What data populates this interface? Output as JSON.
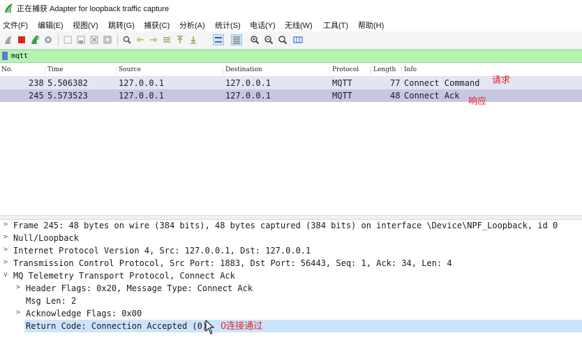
{
  "window": {
    "title": "正在捕获 Adapter for loopback traffic capture"
  },
  "menu": [
    "文件(F)",
    "编辑(E)",
    "视图(V)",
    "跳转(G)",
    "捕获(C)",
    "分析(A)",
    "统计(S)",
    "电话(Y)",
    "无线(W)",
    "工具(T)",
    "帮助(H)"
  ],
  "filter": {
    "value": "mqtt"
  },
  "columns": [
    "No.",
    "Time",
    "Source",
    "Destination",
    "Protocol",
    "Length",
    "Info"
  ],
  "packets": [
    {
      "no": "238",
      "time": "5.506382",
      "source": "127.0.0.1",
      "destination": "127.0.0.1",
      "protocol": "MQTT",
      "length": "77",
      "info": "Connect Command"
    },
    {
      "no": "245",
      "time": "5.573523",
      "source": "127.0.0.1",
      "destination": "127.0.0.1",
      "protocol": "MQTT",
      "length": "48",
      "info": "Connect Ack"
    }
  ],
  "annotations": {
    "request": "请求",
    "response": "响应",
    "accepted": "0连接通过"
  },
  "details": [
    {
      "arrow": ">",
      "text": "Frame 245: 48 bytes on wire (384 bits), 48 bytes captured (384 bits) on interface \\Device\\NPF_Loopback, id 0"
    },
    {
      "arrow": ">",
      "text": "Null/Loopback"
    },
    {
      "arrow": ">",
      "text": "Internet Protocol Version 4, Src: 127.0.0.1, Dst: 127.0.0.1"
    },
    {
      "arrow": ">",
      "text": "Transmission Control Protocol, Src Port: 1883, Dst Port: 56443, Seq: 1, Ack: 34, Len: 4"
    },
    {
      "arrow": "v",
      "text": "MQ Telemetry Transport Protocol, Connect Ack"
    },
    {
      "arrow": ">",
      "text": "Header Flags: 0x20, Message Type: Connect Ack"
    },
    {
      "arrow": "",
      "text": "Msg Len: 2"
    },
    {
      "arrow": ">",
      "text": "Acknowledge Flags: 0x00"
    },
    {
      "arrow": "",
      "text": "Return Code: Connection Accepted (0)"
    }
  ],
  "colors": {
    "filter_bg": "#b3f4b3",
    "row_selected": "#c7c7e0",
    "row_normal": "#e4e4f4",
    "annotation": "#e0232e",
    "tree_selected": "#cce4fa"
  },
  "icons": [
    "shark-fin-start-icon",
    "stop-icon",
    "restart-icon",
    "options-icon",
    "open-icon",
    "save-icon",
    "close-file-icon",
    "reload-icon",
    "find-icon",
    "back-icon",
    "forward-icon",
    "goto-icon",
    "first-icon",
    "last-icon",
    "autoscroll-icon",
    "colorize-icon",
    "zoom-in-icon",
    "zoom-out-icon",
    "zoom-normal-icon",
    "resize-columns-icon"
  ]
}
